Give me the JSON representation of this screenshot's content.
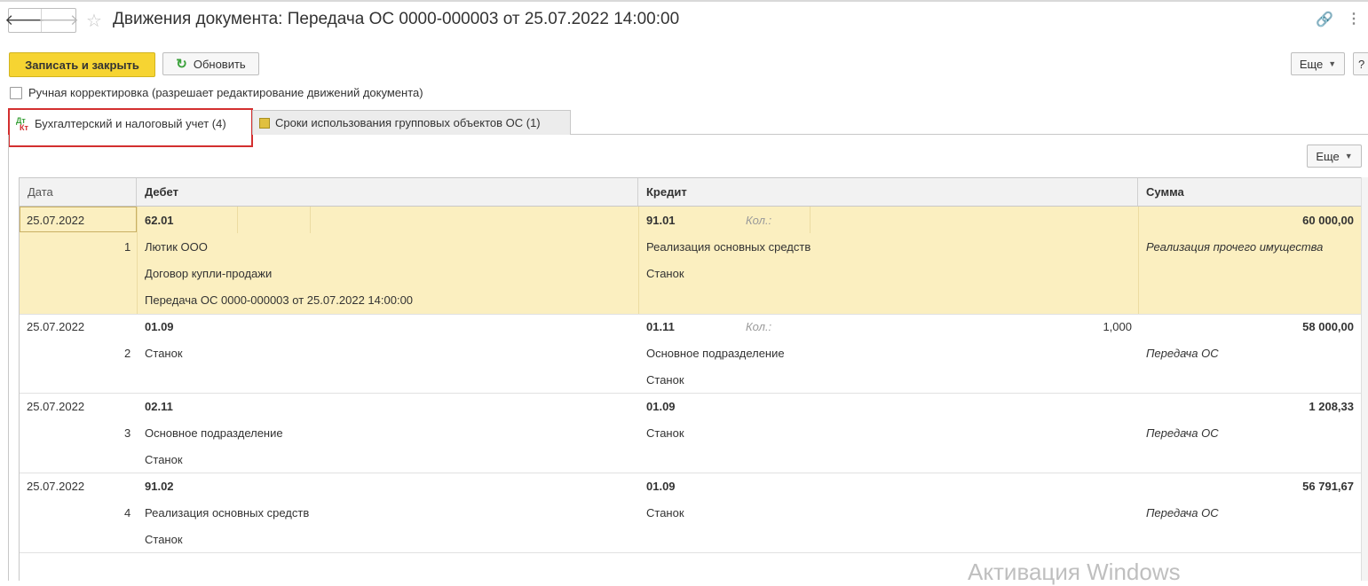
{
  "window": {
    "title": "Движения документа: Передача ОС 0000-000003 от 25.07.2022 14:00:00"
  },
  "toolbar": {
    "save_close_label": "Записать и закрыть",
    "refresh_label": "Обновить",
    "more_label": "Еще",
    "help_label": "?"
  },
  "manual_edit": {
    "label": "Ручная корректировка (разрешает редактирование движений документа)",
    "checked": false
  },
  "tabs": [
    {
      "label": "Бухгалтерский и налоговый учет (4)",
      "icon": "dt-kt-icon",
      "active": true
    },
    {
      "label": "Сроки использования групповых объектов ОС (1)",
      "icon": "register-icon",
      "active": false
    }
  ],
  "table": {
    "more_label": "Еще",
    "columns": {
      "date": "Дата",
      "debit": "Дебет",
      "credit": "Кредит",
      "sum": "Сумма"
    },
    "rows": [
      {
        "date": "25.07.2022",
        "num": "1",
        "debit_account": "62.01",
        "debit_lines": [
          "Лютик ООО",
          "Договор купли-продажи",
          "Передача ОС 0000-000003 от 25.07.2022 14:00:00"
        ],
        "credit_account": "91.01",
        "credit_qty_label": "Кол.:",
        "credit_qty": "",
        "credit_lines": [
          "Реализация основных средств",
          "Станок"
        ],
        "sum": "60 000,00",
        "content": "Реализация прочего имущества",
        "selected": true
      },
      {
        "date": "25.07.2022",
        "num": "2",
        "debit_account": "01.09",
        "debit_lines": [
          "Станок"
        ],
        "credit_account": "01.11",
        "credit_qty_label": "Кол.:",
        "credit_qty": "1,000",
        "credit_lines": [
          "Основное подразделение",
          "Станок"
        ],
        "sum": "58 000,00",
        "content": "Передача ОС",
        "selected": false
      },
      {
        "date": "25.07.2022",
        "num": "3",
        "debit_account": "02.11",
        "debit_lines": [
          "Основное подразделение",
          "Станок"
        ],
        "credit_account": "01.09",
        "credit_qty_label": "",
        "credit_qty": "",
        "credit_lines": [
          "Станок"
        ],
        "sum": "1 208,33",
        "content": "Передача ОС",
        "selected": false
      },
      {
        "date": "25.07.2022",
        "num": "4",
        "debit_account": "91.02",
        "debit_lines": [
          "Реализация основных средств",
          "Станок"
        ],
        "credit_account": "01.09",
        "credit_qty_label": "",
        "credit_qty": "",
        "credit_lines": [
          "Станок"
        ],
        "sum": "56 791,67",
        "content": "Передача ОС",
        "selected": false
      }
    ]
  },
  "watermark": "Активация Windows",
  "colors": {
    "primary_button": "#f6d432",
    "selected_row": "#fbefc0",
    "tab_highlight": "#d32f2f",
    "refresh_icon": "#3aa13a"
  }
}
